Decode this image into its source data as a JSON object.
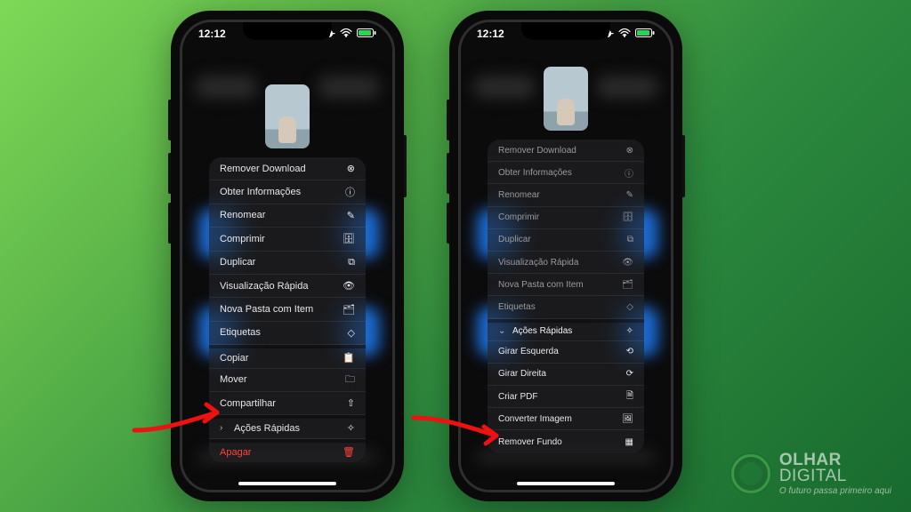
{
  "status": {
    "time": "12:12"
  },
  "left_menu": {
    "items": [
      {
        "label": "Remover Download",
        "icon": "⊗",
        "chev": ""
      },
      {
        "label": "Obter Informações",
        "icon": "ⓘ",
        "chev": ""
      },
      {
        "label": "Renomear",
        "icon": "✎",
        "chev": ""
      },
      {
        "label": "Comprimir",
        "icon": "🗄",
        "chev": ""
      },
      {
        "label": "Duplicar",
        "icon": "⧉",
        "chev": ""
      },
      {
        "label": "Visualização Rápida",
        "icon": "👁",
        "chev": ""
      },
      {
        "label": "Nova Pasta com Item",
        "icon": "🗂",
        "chev": ""
      },
      {
        "label": "Etiquetas",
        "icon": "◇",
        "chev": ""
      },
      {
        "label": "Copiar",
        "icon": "📋",
        "chev": "",
        "sep": true
      },
      {
        "label": "Mover",
        "icon": "🗀",
        "chev": ""
      },
      {
        "label": "Compartilhar",
        "icon": "⇧",
        "chev": ""
      },
      {
        "label": "Ações Rápidas",
        "icon": "✧",
        "chev": "›",
        "sep": true
      },
      {
        "label": "Apagar",
        "icon": "🗑",
        "chev": "",
        "danger": true,
        "sep": true
      }
    ]
  },
  "right_menu": {
    "items": [
      {
        "label": "Remover Download",
        "icon": "⊗",
        "dim": true
      },
      {
        "label": "Obter Informações",
        "icon": "ⓘ",
        "dim": true
      },
      {
        "label": "Renomear",
        "icon": "✎",
        "dim": true
      },
      {
        "label": "Comprimir",
        "icon": "🗄",
        "dim": true
      },
      {
        "label": "Duplicar",
        "icon": "⧉",
        "dim": true
      },
      {
        "label": "Visualização Rápida",
        "icon": "👁",
        "dim": true
      },
      {
        "label": "Nova Pasta com Item",
        "icon": "🗂",
        "dim": true
      },
      {
        "label": "Etiquetas",
        "icon": "◇",
        "dim": true
      },
      {
        "label": "Ações Rápidas",
        "icon": "✧",
        "chev": "⌄",
        "header": true,
        "sep": true
      },
      {
        "label": "Girar Esquerda",
        "icon": "⟲"
      },
      {
        "label": "Girar Direita",
        "icon": "⟳"
      },
      {
        "label": "Criar PDF",
        "icon": "🗎"
      },
      {
        "label": "Converter Imagem",
        "icon": "🖼"
      },
      {
        "label": "Remover Fundo",
        "icon": "▦"
      }
    ]
  },
  "brand": {
    "line1a": "OLHAR",
    "line1b": "DIGITAL",
    "tagline": "O futuro passa primeiro aqui"
  }
}
